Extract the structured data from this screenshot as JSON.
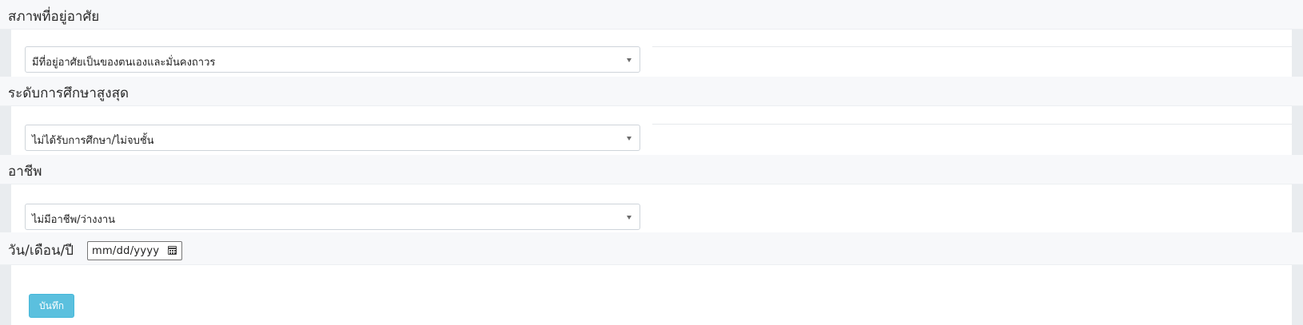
{
  "sections": [
    {
      "title": "สภาพที่อยู่อาศัย",
      "selected": "มีที่อยู่อาศัยเป็นของตนเองและมั่นคงถาวร"
    },
    {
      "title": "ระดับการศึกษาสูงสุด",
      "selected": "ไม่ได้รับการศึกษา/ไม่จบชั้น"
    },
    {
      "title": "อาชีพ",
      "selected": "ไม่มีอาชีพ/ว่างงาน"
    }
  ],
  "date": {
    "label": "วัน/เดือน/ปี",
    "placeholder": "mm/dd/yyyy",
    "icon": "calendar-icon"
  },
  "save_button": {
    "label": "บันทึก"
  },
  "colors": {
    "header_bg": "#f7f8fa",
    "gutter_bg": "#e9ecef",
    "button_bg": "#5bc0de",
    "button_text": "#ffffff"
  }
}
